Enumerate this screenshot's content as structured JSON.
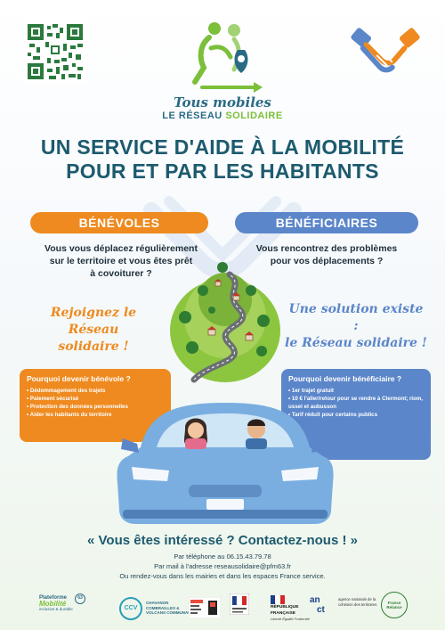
{
  "header": {
    "logo_title": "Tous mobiles",
    "logo_sub_part1": "LE RÉSEAU",
    "logo_sub_part2": "SOLIDAIRE",
    "qr_icon": "qr-code-icon",
    "handshake_icon": "handshake-icon"
  },
  "headline": {
    "line1": "UN SERVICE D'AIDE À LA MOBILITÉ",
    "line2": "POUR ET PAR LES HABITANTS"
  },
  "volunteers": {
    "banner": "BÉNÉVOLES",
    "question_line1": "Vous vous déplacez régulièrement",
    "question_line2": "sur le territoire et vous êtes prêt",
    "question_line3": "à covoiturer ?",
    "script_line1": "Rejoignez le Réseau",
    "script_line2": "solidaire !",
    "box_title": "Pourquoi devenir bénévole ?",
    "items": [
      "Dédommagement des trajets",
      "Paiement sécurisé",
      "Protection des données personnelles",
      "Aider les habitants du territoire"
    ]
  },
  "beneficiaries": {
    "banner": "BÉNÉFICIAIRES",
    "question_line1": "Vous rencontrez des problèmes",
    "question_line2": "pour vos déplacements ?",
    "script_line1": "Une solution existe :",
    "script_line2": "le Réseau solidaire !",
    "box_title": "Pourquoi devenir bénéficiaire ?",
    "items": [
      "1er trajet gratuit",
      "10 € l'aller/retour pour se rendre à Clermont; riom, ussel et aubusson",
      "Tarif réduit pour certains publics"
    ]
  },
  "contact": {
    "cta": "« Vous êtes intéressé ? Contactez-nous ! »",
    "phone": "Par téléphone au 06.15.43.79.78",
    "email": "Par mail à l'adresse reseausolidaire@pfm63.fr",
    "places": "Ou rendez-vous dans les mairies et dans les espaces France service."
  },
  "partners": {
    "plateforme_name": "Plateforme",
    "plateforme_brand": "Mobilité",
    "plateforme_tag": "inclusive & durable",
    "plateforme_num": "63",
    "ccv_abbr": "CCV",
    "ccv_name": "CHAVANON COMBRAILLES & VOLCANS COMMUNAUTÉ",
    "rf_name": "RÉPUBLIQUE FRANÇAISE",
    "rf_motto": "Liberté Égalité Fraternité",
    "anct_abbr": "an",
    "anct_abbr2": "ct",
    "anct_name": "agence nationale de la cohésion des territoires",
    "fr_service": "France Relance"
  },
  "colors": {
    "orange": "#ee8a1f",
    "blue": "#5b86c9",
    "teal": "#1d5a6e",
    "green": "#7bbf3a"
  }
}
